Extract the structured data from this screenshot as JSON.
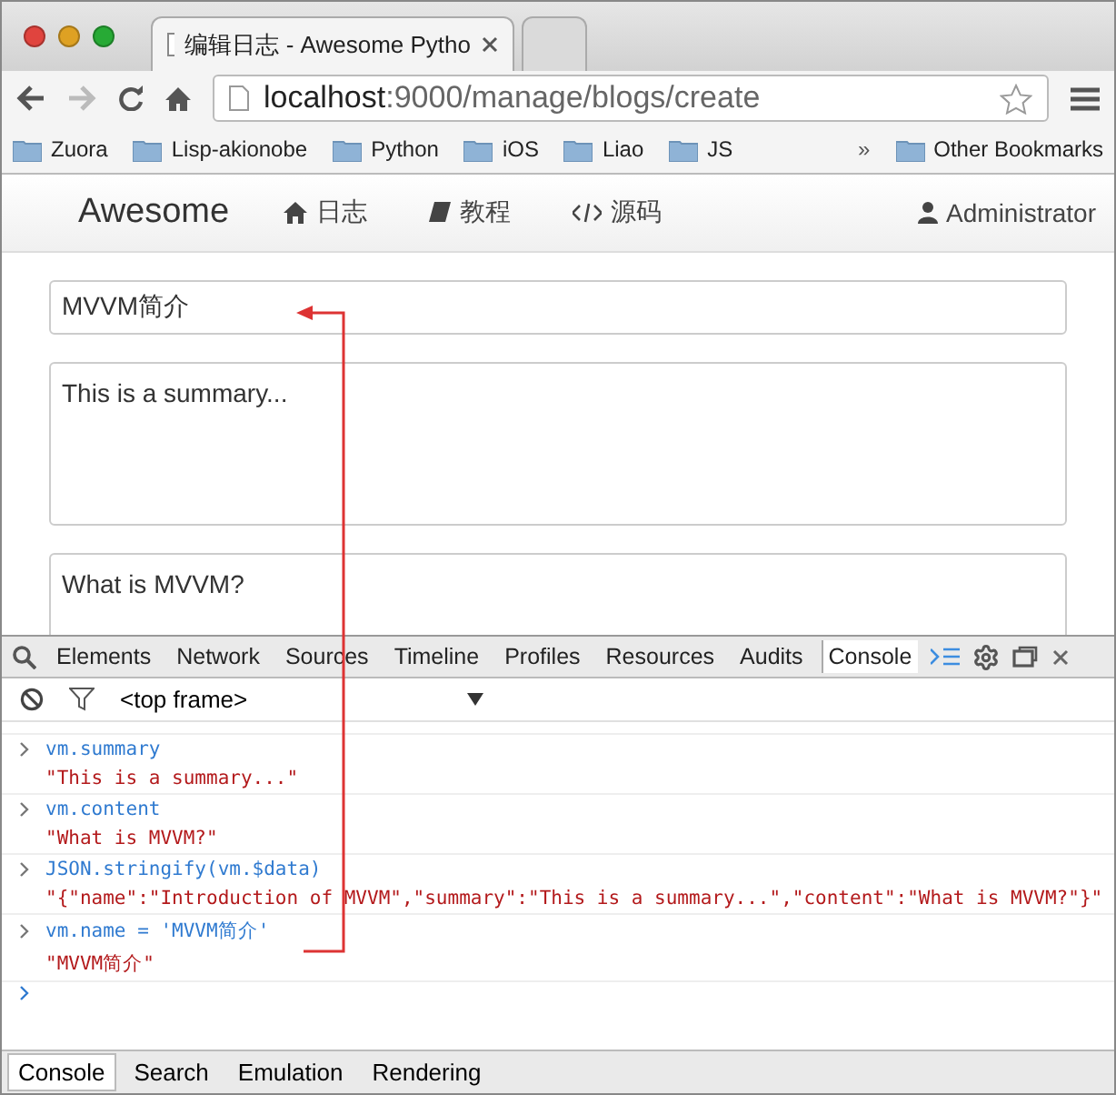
{
  "browser": {
    "tabs": [
      {
        "title": "编辑日志 - Awesome Pytho",
        "selected": true
      },
      {
        "selected": false
      }
    ],
    "url": {
      "host": "localhost",
      "path": ":9000/manage/blogs/create"
    },
    "bookmarks": [
      "Zuora",
      "Lisp-akionobe",
      "Python",
      "iOS",
      "Liao",
      "JS"
    ],
    "more": "»",
    "other_bookmarks": "Other Bookmarks"
  },
  "navbar": {
    "brand": "Awesome",
    "items": [
      {
        "label": "日志"
      },
      {
        "label": "教程"
      },
      {
        "label": "源码"
      }
    ],
    "user": "Administrator"
  },
  "form": {
    "name": "MVVM简介",
    "summary": "This is a summary...",
    "content": "What is MVVM?"
  },
  "devtools": {
    "tabs": [
      {
        "label": "Elements",
        "selected": false
      },
      {
        "label": "Network",
        "selected": false
      },
      {
        "label": "Sources",
        "selected": false
      },
      {
        "label": "Timeline",
        "selected": false
      },
      {
        "label": "Profiles",
        "selected": false
      },
      {
        "label": "Resources",
        "selected": false
      },
      {
        "label": "Audits",
        "selected": false
      },
      {
        "label": "Console",
        "selected": true
      }
    ],
    "frame": "<top frame>",
    "console": [
      {
        "kind": "input",
        "text": "vm.summary"
      },
      {
        "kind": "output",
        "text": "\"This is a summary...\""
      },
      {
        "kind": "input",
        "text": "vm.content"
      },
      {
        "kind": "output",
        "text": "\"What is MVVM?\""
      },
      {
        "kind": "input",
        "text": "JSON.stringify(vm.$data)"
      },
      {
        "kind": "output",
        "text": "\"{\"name\":\"Introduction of MVVM\",\"summary\":\"This is a summary...\",\"content\":\"What is MVVM?\"}\""
      },
      {
        "kind": "input",
        "text": "vm.name = 'MVVM简介'"
      },
      {
        "kind": "output",
        "text": "\"MVVM简介\""
      }
    ],
    "drawer_tabs": [
      {
        "label": "Console",
        "selected": true
      },
      {
        "label": "Search",
        "selected": false
      },
      {
        "label": "Emulation",
        "selected": false
      },
      {
        "label": "Rendering",
        "selected": false
      }
    ]
  }
}
